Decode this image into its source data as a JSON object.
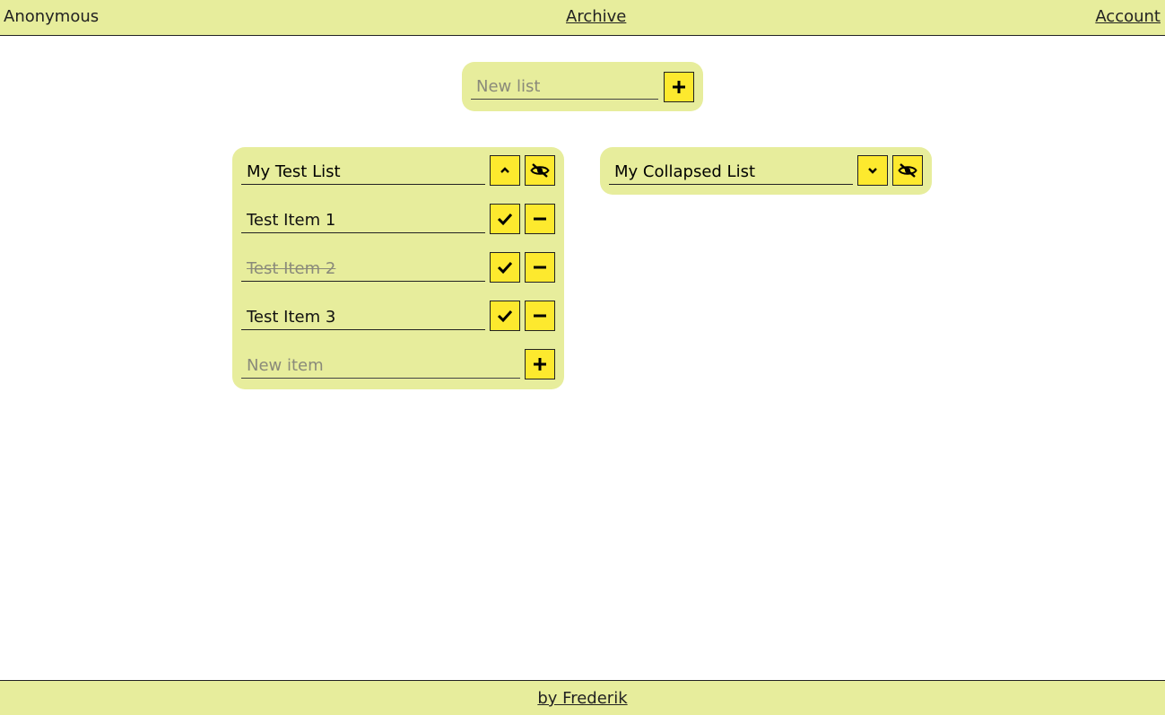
{
  "header": {
    "user_label": "Anonymous",
    "archive_link": "Archive",
    "account_link": "Account"
  },
  "new_list": {
    "placeholder": "New list",
    "add_icon": "plus-icon"
  },
  "lists": [
    {
      "title": "My Test List",
      "collapse_icon": "chevron-up-icon",
      "hide_icon": "eye-off-icon",
      "items": [
        {
          "label": "Test Item 1",
          "done": false
        },
        {
          "label": "Test Item 2",
          "done": true
        },
        {
          "label": "Test Item 3",
          "done": false
        }
      ],
      "new_item_placeholder": "New item"
    },
    {
      "title": "My Collapsed List",
      "collapse_icon": "chevron-down-icon",
      "hide_icon": "eye-off-icon",
      "collapsed": true
    }
  ],
  "footer": {
    "credit_link": "by Frederik"
  },
  "colors": {
    "panel_bg": "#e7ed9c",
    "button_bg": "#fde92e"
  }
}
